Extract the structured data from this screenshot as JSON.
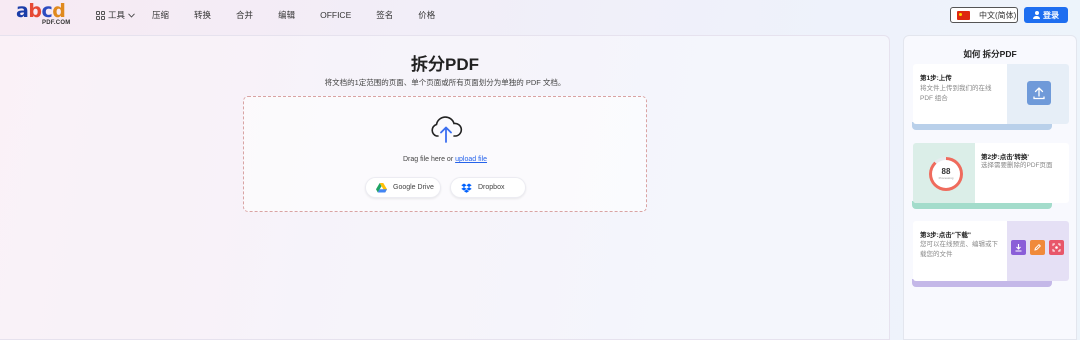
{
  "logo": {
    "letters": [
      "a",
      "b",
      "c",
      "d"
    ],
    "colors": [
      "#1b3da8",
      "#e64a35",
      "#2c4cc0",
      "#e08a1e"
    ],
    "sub": "PDF.COM"
  },
  "nav": {
    "tools_label": "工具",
    "items": [
      "压缩",
      "转换",
      "合并",
      "编辑",
      "OFFICE",
      "签名",
      "价格"
    ]
  },
  "header": {
    "lang_label": "中文(简体)",
    "login_label": "登录"
  },
  "main": {
    "title": "拆分PDF",
    "subtitle": "将文档的1定范围的页面、单个页面或所有页面划分为单独的 PDF 文档。",
    "drag_text": "Drag file here or ",
    "upload_link": "upload file",
    "google_drive": "Google Drive",
    "dropbox": "Dropbox"
  },
  "side": {
    "title": "如何 拆分PDF",
    "steps": [
      {
        "title": "第1步:上传",
        "desc": "将文件上传到我们的在线PDF 组合"
      },
      {
        "title": "第2步:点击'转换'",
        "desc": "选择需要删除的PDF页面"
      },
      {
        "title": "第3步:点击\"下载\"",
        "desc": "您可以在线预览、编辑或下载您的文件"
      }
    ],
    "gauge_value": "88",
    "gauge_percent": 88,
    "gauge_label": "Processing"
  },
  "colors": {
    "accent": "#1e6ef0",
    "link": "#2563eb"
  }
}
